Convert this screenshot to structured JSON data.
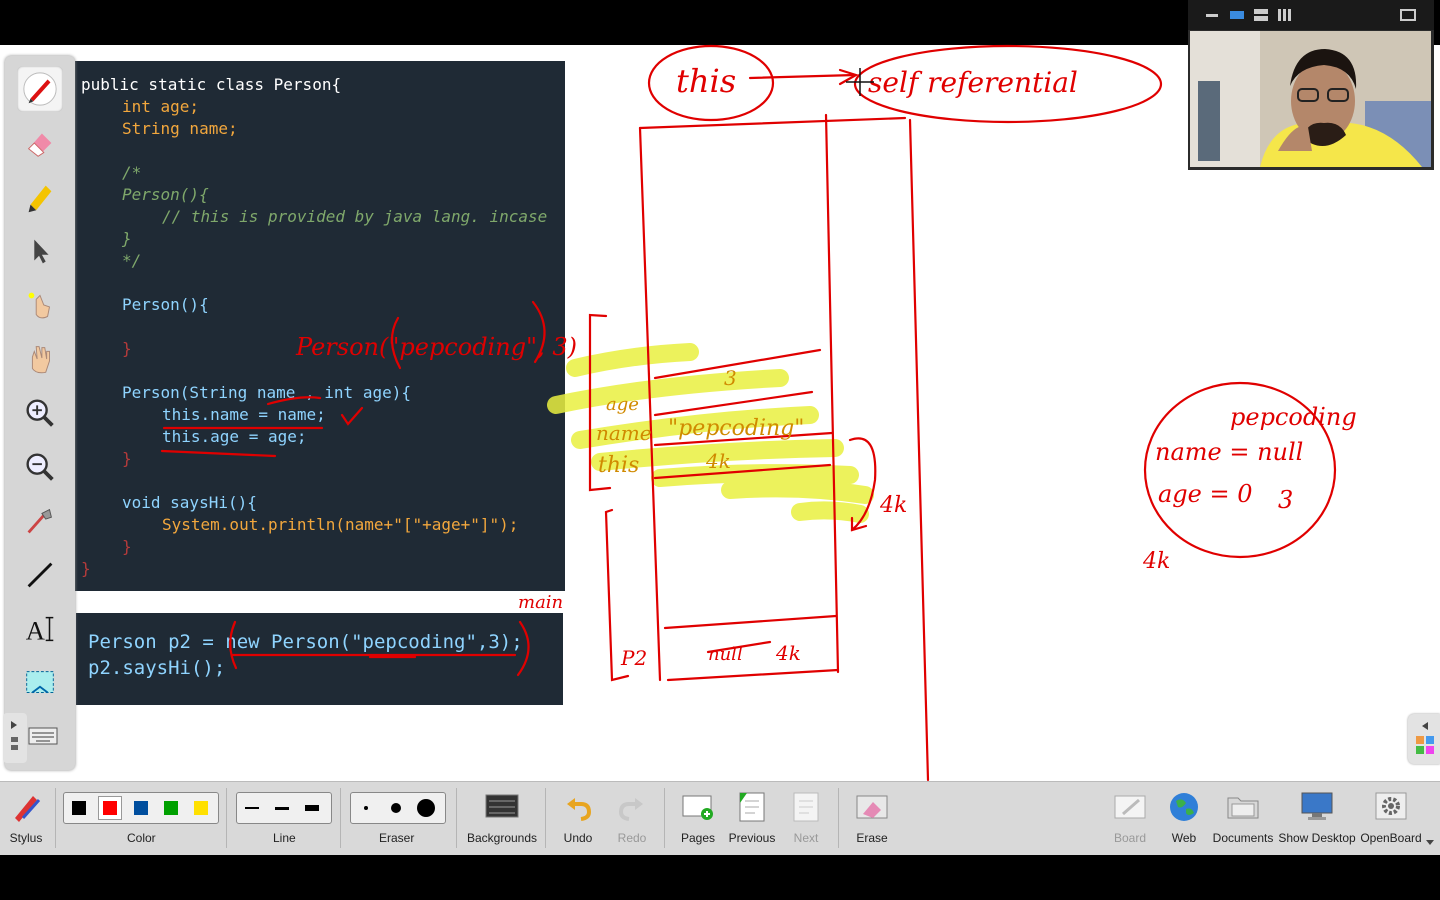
{
  "code_panel_main": {
    "lines": [
      "public static class Person{",
      "int age;",
      "String name;",
      "/*",
      "Person(){",
      "// this is provided by java lang. incase",
      "}",
      "*/",
      "Person(){",
      "}",
      "Person(String name , int age){",
      "this.name = name;",
      "this.age = age;",
      "}",
      "void saysHi(){",
      "System.out.println(name+\"[\"+age+\"]\");",
      "}",
      "}"
    ]
  },
  "code_panel_main_call": {
    "lines": [
      "Person p2 = new Person(\"pepcoding\",3);",
      "p2.saysHi();"
    ]
  },
  "ink_notes": {
    "this": "this",
    "self_ref": "self referential",
    "person_call": "Person(\"pepcoding\", 3)",
    "main": "main",
    "age": "age",
    "name": "name",
    "this_field": "this",
    "val_3": "3",
    "val_pepcoding": "\"pepcoding\"",
    "val_4k_field": "4k",
    "val_4k_arrow": "4k",
    "p2": "P2",
    "null_4k": "4k",
    "obj_name": "name = null",
    "obj_name_new": "pepcoding",
    "obj_age": "age = 0",
    "obj_age_new": "3",
    "obj_addr": "4k"
  },
  "toolbar": {
    "stylus": "Stylus",
    "color": "Color",
    "line": "Line",
    "eraser": "Eraser",
    "backgrounds": "Backgrounds",
    "undo": "Undo",
    "redo": "Redo",
    "pages": "Pages",
    "previous": "Previous",
    "next": "Next",
    "erase": "Erase",
    "board": "Board",
    "web": "Web",
    "documents": "Documents",
    "show_desktop": "Show Desktop",
    "openboard": "OpenBoard"
  },
  "colors": {
    "palette": [
      "#000000",
      "#ff0000",
      "#004e9e",
      "#00a000",
      "#ffe000"
    ],
    "ink_red": "#e00000",
    "highlighter": "#e9f040"
  },
  "icons": {
    "tools": [
      "pen-icon",
      "eraser-icon",
      "highlighter-icon",
      "pointer-icon",
      "laser-icon",
      "hand-icon",
      "zoom-in-icon",
      "zoom-out-icon",
      "capture-icon",
      "line-icon",
      "text-icon",
      "selection-icon"
    ]
  }
}
